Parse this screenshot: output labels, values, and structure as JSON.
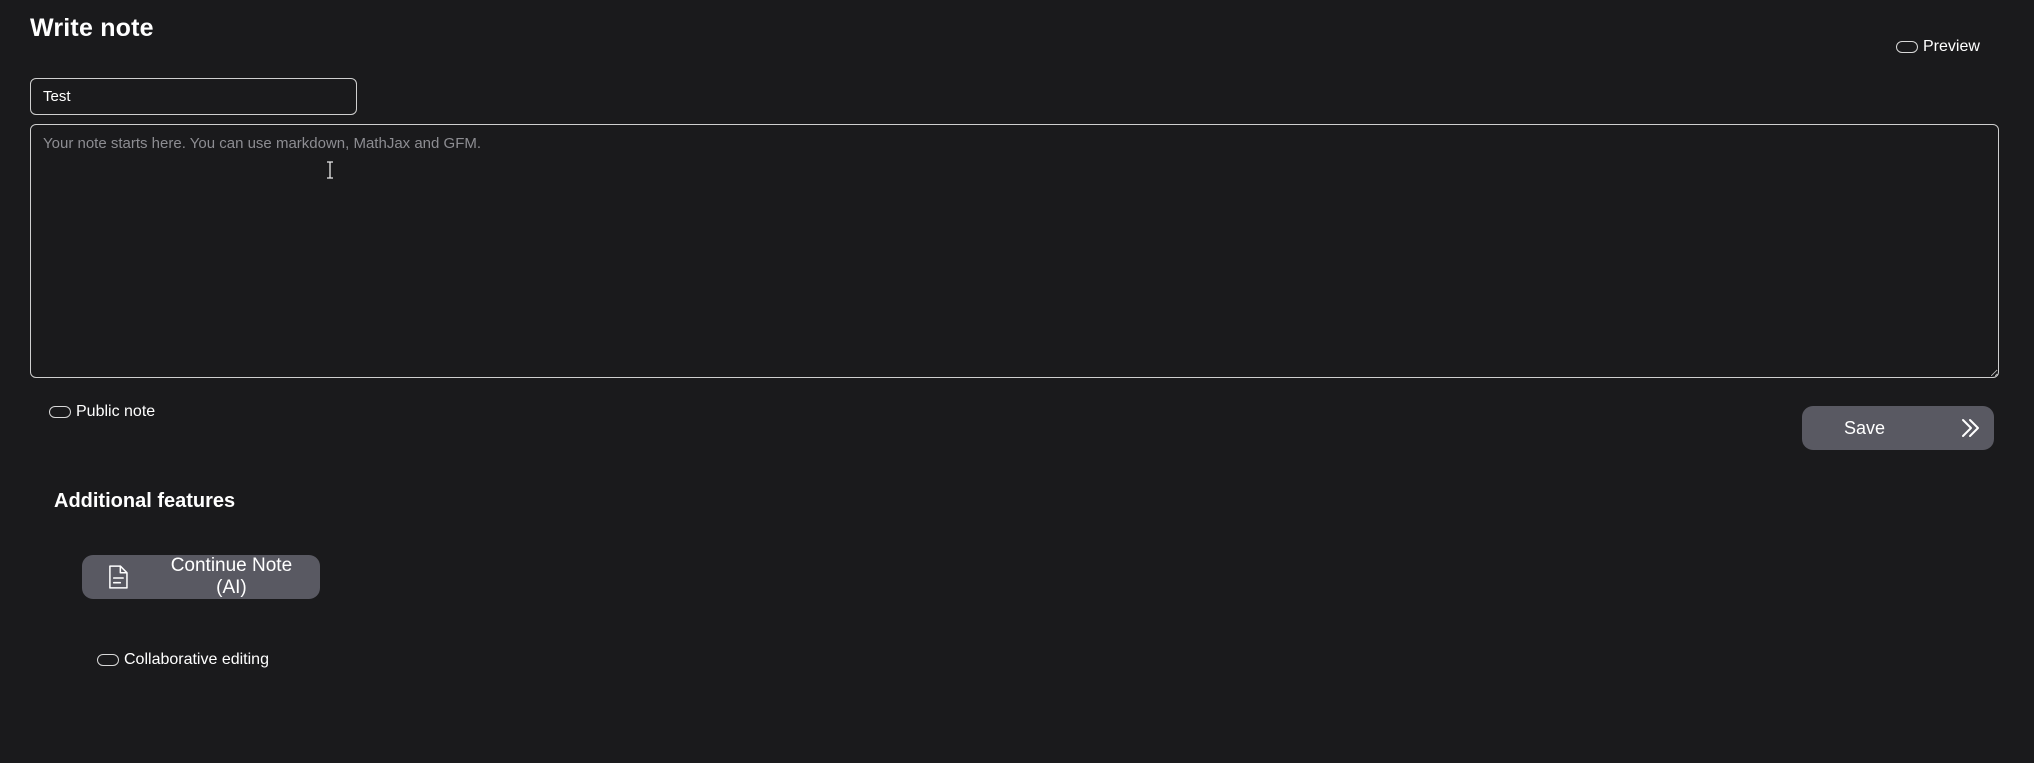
{
  "header": {
    "title": "Write note"
  },
  "preview_toggle": {
    "label": "Preview"
  },
  "title_input": {
    "value": "Test"
  },
  "note_editor": {
    "value": "",
    "placeholder": "Your note starts here. You can use markdown, MathJax and GFM."
  },
  "public_toggle": {
    "label": "Public note"
  },
  "save_button": {
    "label": "Save",
    "icon": "double-chevron-right-icon"
  },
  "additional_features": {
    "title": "Additional features",
    "continue_note_button": {
      "label": "Continue Note (AI)",
      "icon": "document-icon"
    },
    "collaborative_toggle": {
      "label": "Collaborative editing"
    }
  },
  "colors": {
    "background": "#1a1a1c",
    "button": "#595962",
    "border": "#cfcfcf",
    "placeholder": "#8d8d92"
  }
}
